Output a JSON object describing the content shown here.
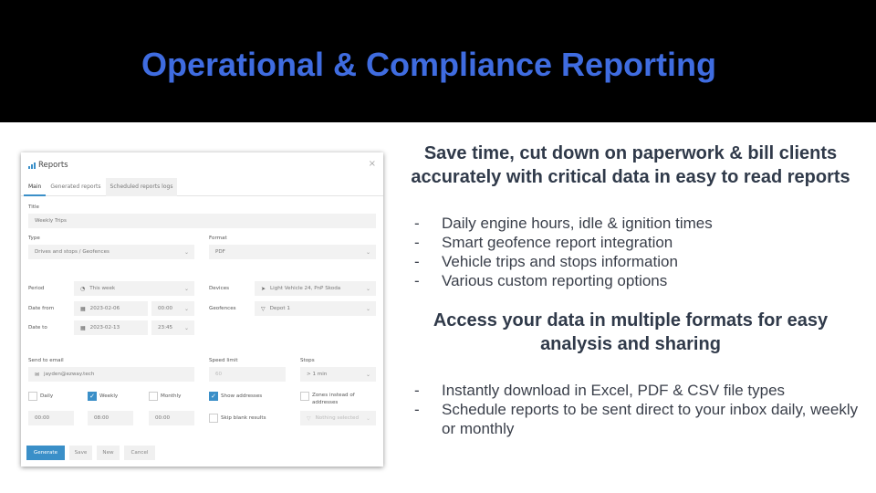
{
  "slide": {
    "title": "Operational & Compliance Reporting",
    "colors": {
      "header_bg": "#000000",
      "title": "#3f6ce0",
      "accent": "#3a8fc8"
    }
  },
  "reports_window": {
    "title": "Reports",
    "close": "×",
    "tabs": [
      "Main",
      "Generated reports",
      "Scheduled reports logs"
    ],
    "title_label": "Title",
    "title_value": "Weekly Trips",
    "type_label": "Type",
    "type_value": "Drives and stops / Geofences",
    "format_label": "Format",
    "format_value": "PDF",
    "period_label": "Period",
    "period_value": "This week",
    "devices_label": "Devices",
    "devices_value": "Light Vehicle 24, PnP Skoda",
    "date_from_label": "Date from",
    "date_from_value": "2023-02-06",
    "time_from_value": "00:00",
    "geofences_label": "Geofences",
    "geofences_value": "Depot 1",
    "date_to_label": "Date to",
    "date_to_value": "2023-02-13",
    "time_to_value": "23:45",
    "send_to_email_label": "Send to email",
    "email_value": "jayden@ezway.tech",
    "speed_limit_label": "Speed limit",
    "speed_limit_placeholder": "60",
    "stops_label": "Stops",
    "stops_value": "> 1 min",
    "daily_label": "Daily",
    "daily_checked": false,
    "weekly_label": "Weekly",
    "weekly_checked": true,
    "monthly_label": "Monthly",
    "monthly_checked": false,
    "show_addresses_label": "Show addresses",
    "show_addresses_checked": true,
    "zones_label": "Zones instead of addresses",
    "zones_checked": false,
    "daily_time": "00:00",
    "weekly_time": "08:00",
    "monthly_time": "00:00",
    "skip_blank_label": "Skip blank results",
    "skip_blank_checked": false,
    "nothing_selected": "Nothing selected",
    "buttons": {
      "generate": "Generate",
      "save": "Save",
      "new": "New",
      "cancel": "Cancel"
    },
    "icons": {
      "period": "clock-icon",
      "devices": "location-arrow-icon",
      "geofences": "geofence-icon",
      "calendar": "calendar-icon",
      "email": "envelope-icon",
      "dropdown": "chevron-down-icon"
    }
  },
  "section1": {
    "heading": "Save time, cut down on paperwork & bill clients accurately with critical data in easy to read reports",
    "bullets": [
      "Daily engine hours, idle & ignition times",
      "Smart geofence report integration",
      "Vehicle trips and stops information",
      "Various custom reporting options"
    ]
  },
  "section2": {
    "heading": "Access your data in multiple formats for easy analysis and sharing",
    "bullets": [
      "Instantly download in Excel, PDF & CSV file types",
      "Schedule reports to be sent direct to your inbox daily, weekly or monthly"
    ]
  }
}
